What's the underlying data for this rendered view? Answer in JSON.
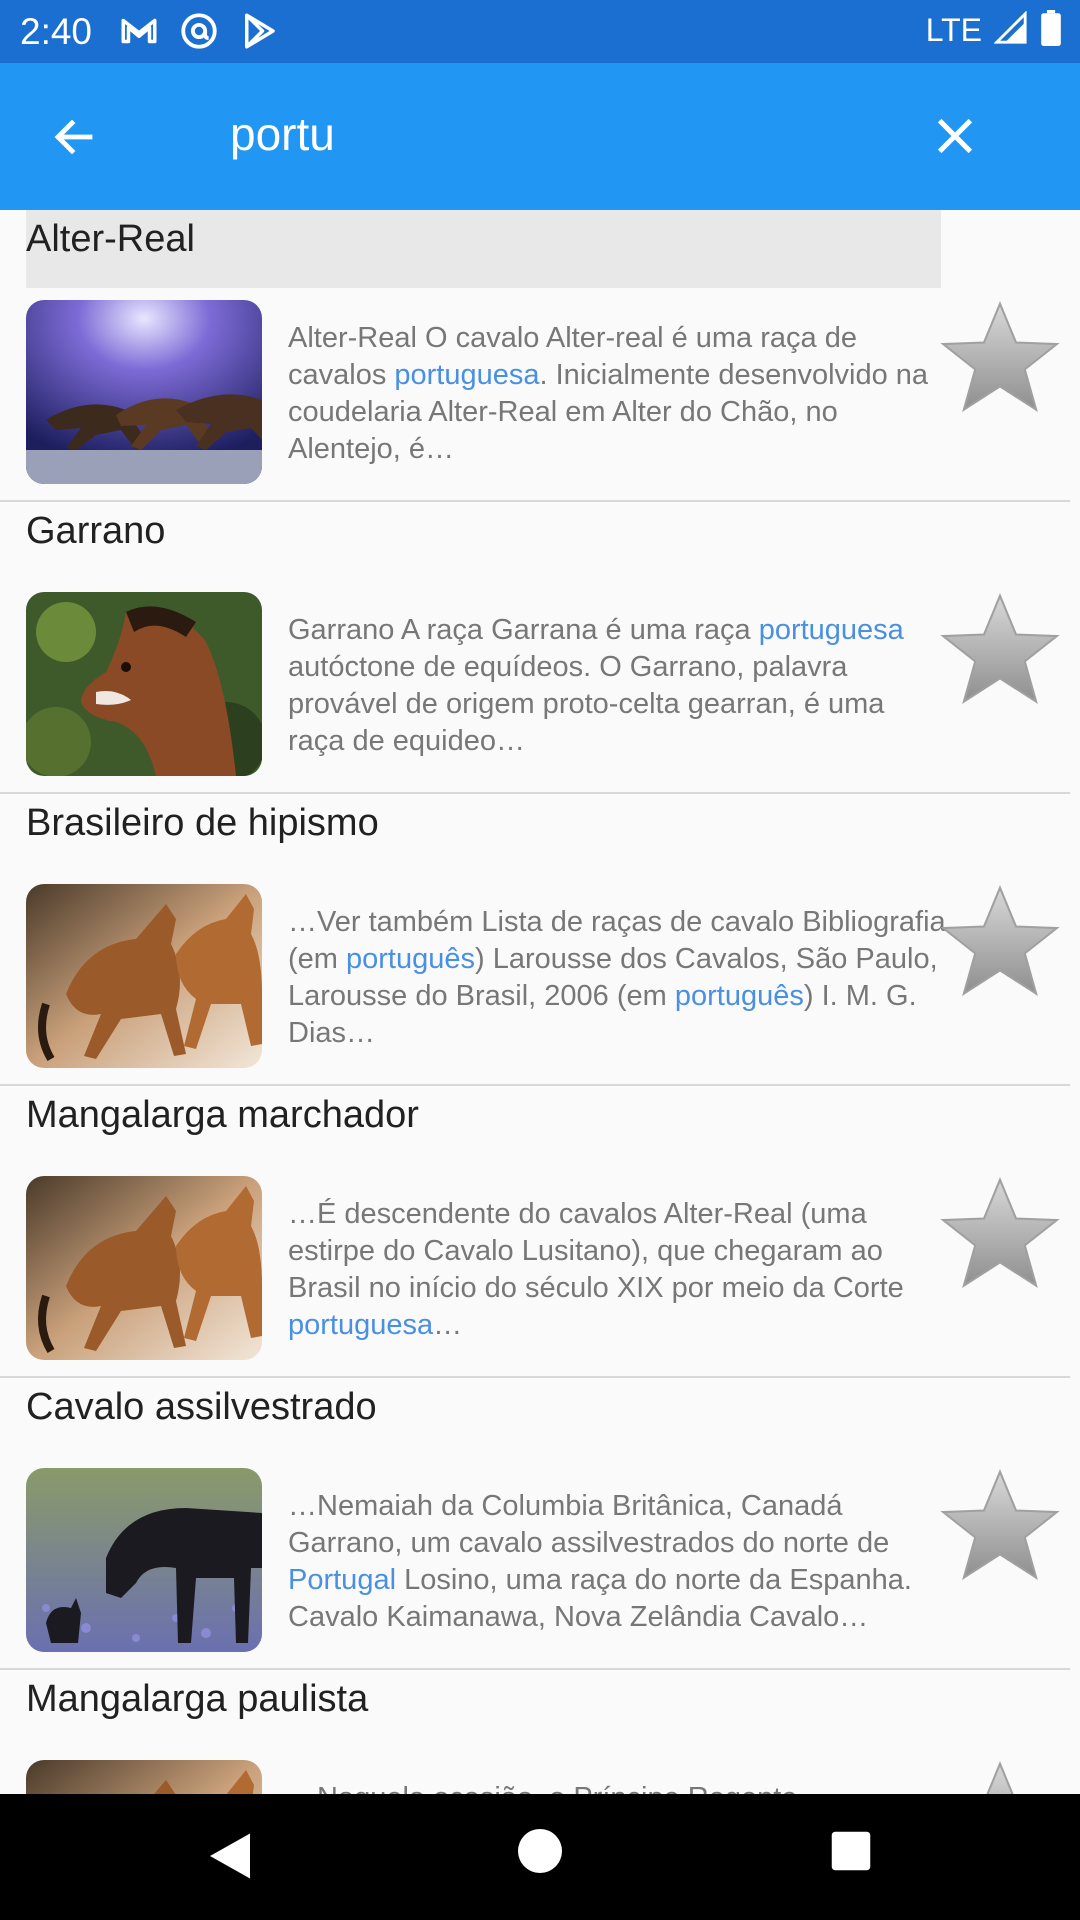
{
  "status_bar": {
    "time": "2:40",
    "network": "LTE",
    "icons": [
      "gmail-icon",
      "at-sign-icon",
      "play-store-icon",
      "signal-icon",
      "battery-icon"
    ]
  },
  "search": {
    "query": "portu"
  },
  "results": [
    {
      "title": "Alter-Real",
      "image": "horses-running-sky-icon",
      "snippet": [
        {
          "t": "Alter-Real O cavalo Alter-real é uma raça de cavalos "
        },
        {
          "t": "portuguesa",
          "hl": true
        },
        {
          "t": ". Inicialmente desenvolvido na coudelaria Alter-Real em Alter do Chão, no Alentejo, é…"
        }
      ]
    },
    {
      "title": "Garrano",
      "image": "horse-head-icon",
      "snippet": [
        {
          "t": "Garrano A raça Garrana é uma raça "
        },
        {
          "t": "portuguesa",
          "hl": true
        },
        {
          "t": " autóctone de equídeos. O Garrano, palavra provável de origem proto-celta gearran, é uma raça de equideo…"
        }
      ]
    },
    {
      "title": "Brasileiro de hipismo",
      "image": "horses-running-icon",
      "snippet": [
        {
          "t": "…Ver também Lista de raças de cavalo Bibliografia (em "
        },
        {
          "t": "português",
          "hl": true
        },
        {
          "t": ") Larousse dos Cavalos, São Paulo, Larousse do Brasil, 2006 (em "
        },
        {
          "t": "português",
          "hl": true
        },
        {
          "t": ") I. M. G. Dias…"
        }
      ]
    },
    {
      "title": "Mangalarga marchador",
      "image": "horses-running-icon",
      "snippet": [
        {
          "t": "…É descendente do cavalos Alter-Real (uma estirpe do Cavalo Lusitano), que chegaram ao Brasil no início do século XIX por meio da Corte "
        },
        {
          "t": "portuguesa",
          "hl": true
        },
        {
          "t": "…"
        }
      ]
    },
    {
      "title": "Cavalo assilvestrado",
      "image": "horses-grazing-icon",
      "snippet": [
        {
          "t": "…Nemaiah da Columbia Britânica, Canadá Garrano, um cavalo assilvestrados do norte de "
        },
        {
          "t": "Portugal",
          "hl": true
        },
        {
          "t": " Losino, uma raça do norte da Espanha. Cavalo Kaimanawa, Nova Zelândia Cavalo…"
        }
      ]
    },
    {
      "title": "Mangalarga paulista",
      "image": "horses-running-icon",
      "snippet": [
        {
          "t": "…Naquela ocasião, o Príncipe Regente"
        }
      ]
    }
  ],
  "colors": {
    "status_bar": "#1a6fd0",
    "app_bar": "#2196f3",
    "highlight": "#4a90e2",
    "selected_title_bg": "#e8e8e8"
  }
}
